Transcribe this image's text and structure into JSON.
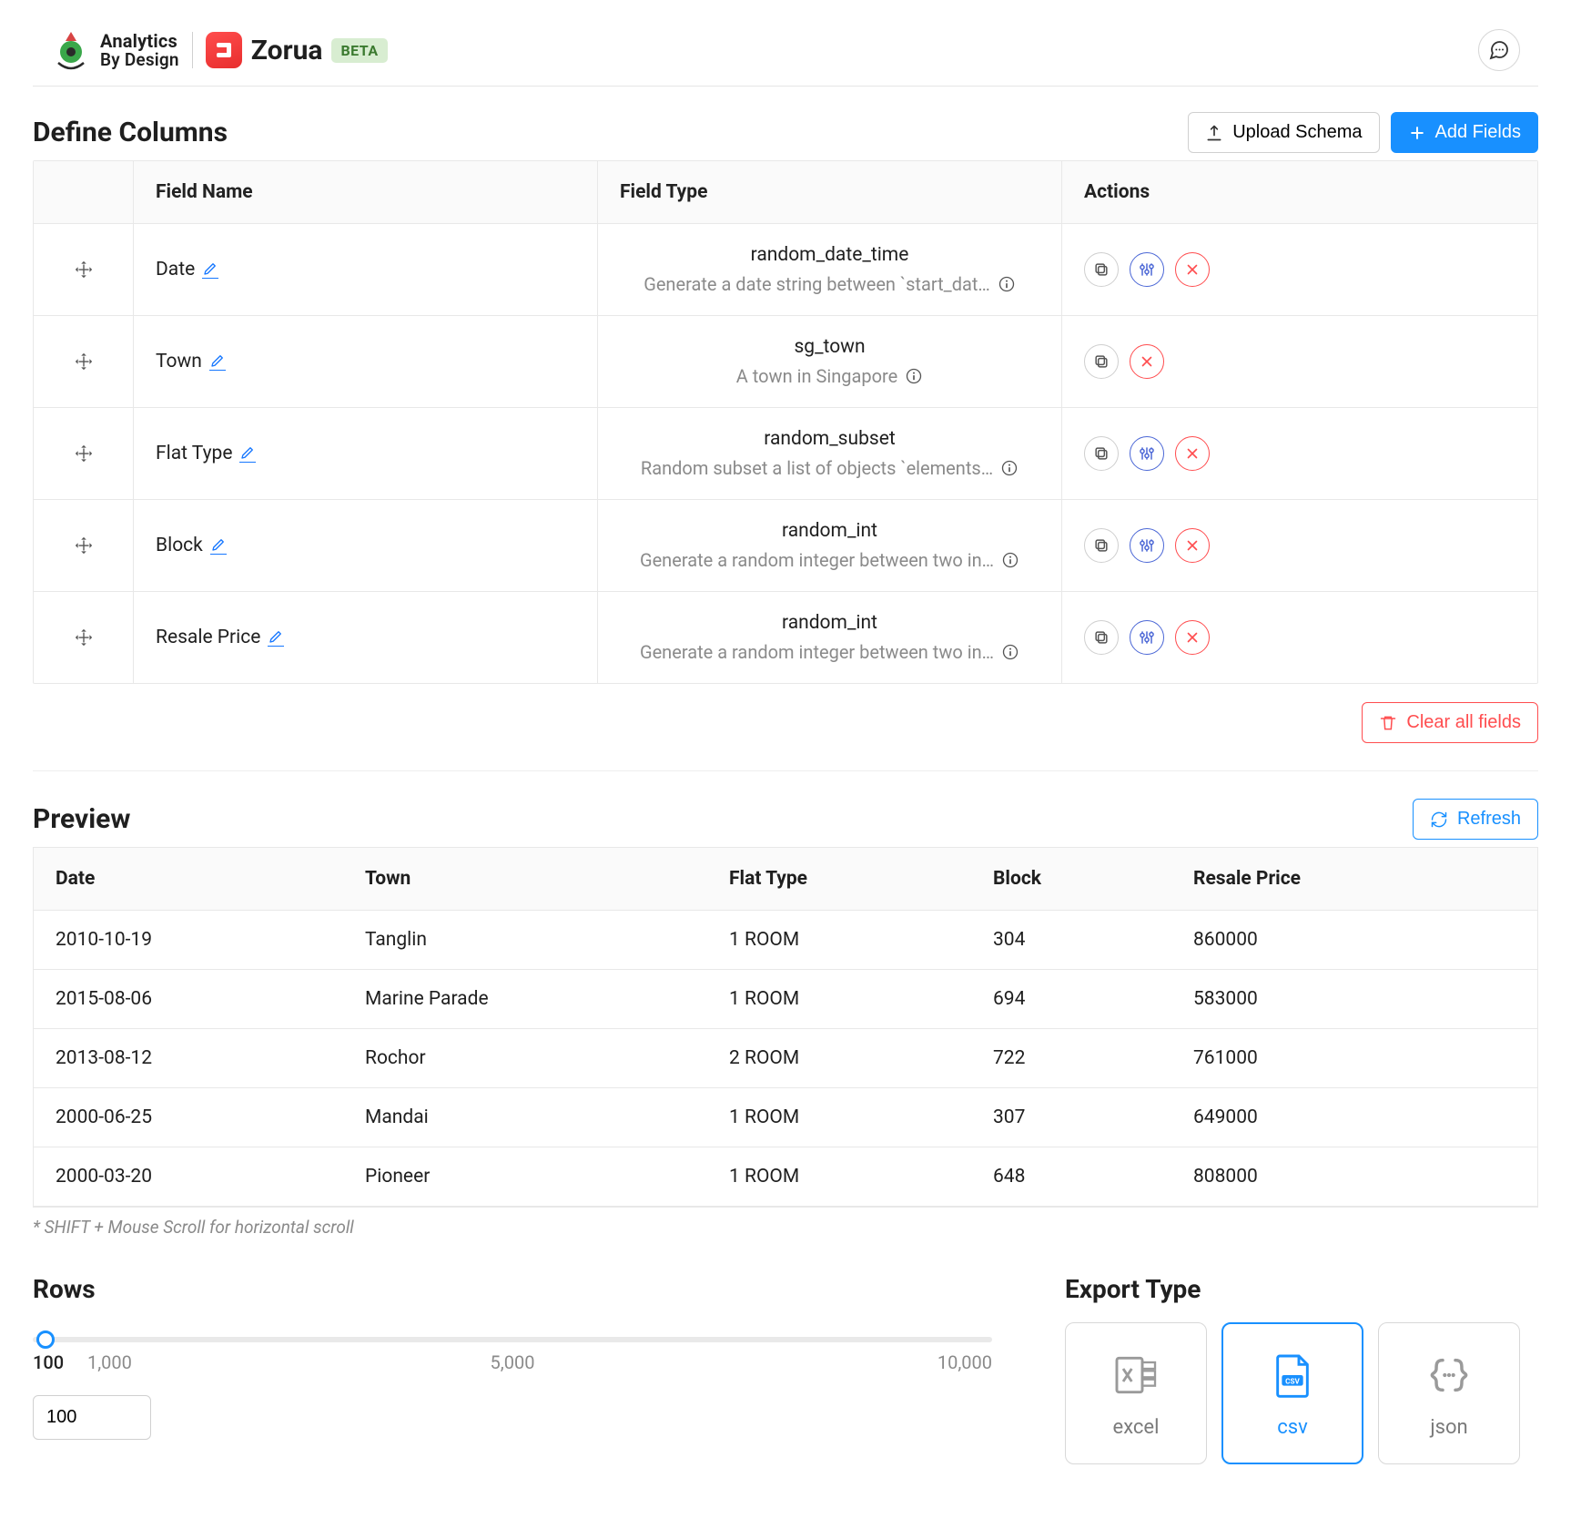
{
  "header": {
    "brand1_line1": "Analytics",
    "brand1_line2": "By Design",
    "brand2": "Zorua",
    "beta": "BETA"
  },
  "define": {
    "title": "Define Columns",
    "upload_label": "Upload Schema",
    "add_label": "Add Fields",
    "clear_label": "Clear all fields",
    "head": {
      "drag": "",
      "name": "Field Name",
      "type": "Field Type",
      "actions": "Actions"
    },
    "rows": [
      {
        "name": "Date",
        "type": "random_date_time",
        "desc": "Generate a date string between `start_dat…",
        "has_tune": true
      },
      {
        "name": "Town",
        "type": "sg_town",
        "desc": "A town in Singapore",
        "has_tune": false
      },
      {
        "name": "Flat Type",
        "type": "random_subset",
        "desc": "Random subset a list of objects `elements…",
        "has_tune": true
      },
      {
        "name": "Block",
        "type": "random_int",
        "desc": "Generate a random integer between two in…",
        "has_tune": true
      },
      {
        "name": "Resale Price",
        "type": "random_int",
        "desc": "Generate a random integer between two in…",
        "has_tune": true
      }
    ]
  },
  "preview": {
    "title": "Preview",
    "refresh_label": "Refresh",
    "hint": "* SHIFT + Mouse Scroll for horizontal scroll",
    "headers": [
      "Date",
      "Town",
      "Flat Type",
      "Block",
      "Resale Price"
    ],
    "rows": [
      [
        "2010-10-19",
        "Tanglin",
        "1 ROOM",
        "304",
        "860000"
      ],
      [
        "2015-08-06",
        "Marine Parade",
        "1 ROOM",
        "694",
        "583000"
      ],
      [
        "2013-08-12",
        "Rochor",
        "2 ROOM",
        "722",
        "761000"
      ],
      [
        "2000-06-25",
        "Mandai",
        "1 ROOM",
        "307",
        "649000"
      ],
      [
        "2000-03-20",
        "Pioneer",
        "1 ROOM",
        "648",
        "808000"
      ]
    ]
  },
  "rows_section": {
    "title": "Rows",
    "marks": {
      "m0": "100",
      "m1": "1,000",
      "mid": "5,000",
      "max": "10,000"
    },
    "value": "100"
  },
  "export": {
    "title": "Export Type",
    "options": [
      {
        "key": "excel",
        "label": "excel",
        "active": false
      },
      {
        "key": "csv",
        "label": "csv",
        "active": true
      },
      {
        "key": "json",
        "label": "json",
        "active": false
      }
    ]
  }
}
